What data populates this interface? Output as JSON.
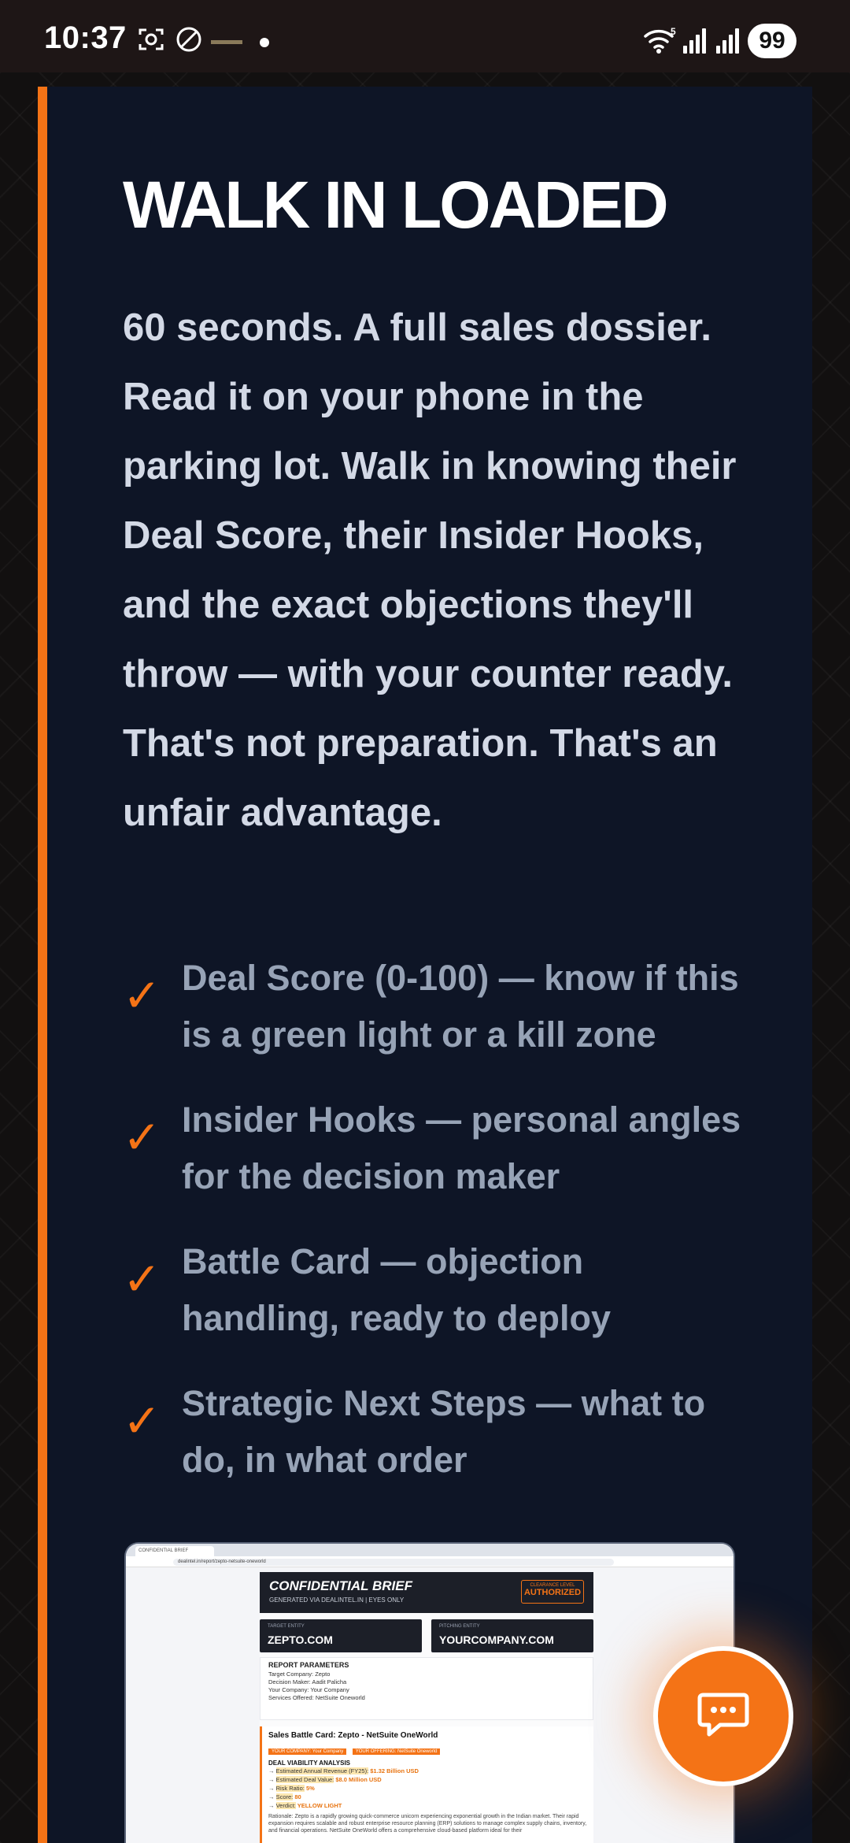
{
  "status_bar": {
    "time": "10:37",
    "battery": "99",
    "icons": [
      "screenshot-icon",
      "do-not-disturb-icon",
      "notification-dot",
      "wifi-icon",
      "signal-icon",
      "signal-icon-2"
    ]
  },
  "hero": {
    "headline": "WALK IN LOADED",
    "body": "60 seconds. A full sales dossier. Read it on your phone in the parking lot. Walk in knowing their Deal Score, their Insider Hooks, and the exact objections they'll throw — with your counter ready. That's not preparation. That's an unfair advantage."
  },
  "features": [
    {
      "check": "✓",
      "text": "Deal Score (0-100) — know if this is a green light or a kill zone"
    },
    {
      "check": "✓",
      "text": "Insider Hooks — personal angles for the decision maker"
    },
    {
      "check": "✓",
      "text": "Battle Card — objection handling, ready to deploy"
    },
    {
      "check": "✓",
      "text": "Strategic Next Steps — what to do, in what order"
    }
  ],
  "preview": {
    "tab_title": "CONFIDENTIAL BRIEF",
    "url": "dealintel.in/report/zepto-netsuite-oneworld",
    "brief_title": "CONFIDENTIAL BRIEF",
    "brief_subtitle": "GENERATED VIA DEALINTEL.IN | EYES ONLY",
    "clearance_label": "CLEARANCE LEVEL",
    "clearance_value": "AUTHORIZED",
    "target_label": "TARGET ENTITY",
    "target_value": "ZEPTO.COM",
    "pitching_label": "PITCHING ENTITY",
    "pitching_value": "YOURCOMPANY.COM",
    "params_heading": "REPORT PARAMETERS",
    "params": [
      "Target Company: Zepto",
      "Decision Maker: Aadit Palicha",
      "Your Company: Your Company",
      "Services Offered: NetSuite Oneworld"
    ],
    "battle_title": "Sales Battle Card: Zepto - NetSuite OneWorld",
    "tag_company": "YOUR COMPANY: Your Company",
    "tag_offering": "YOUR OFFERING: NetSuite Oneworld",
    "viability_heading": "DEAL VIABILITY ANALYSIS",
    "revenue_label": "Estimated Annual Revenue (FY25):",
    "revenue_value": "$1.32 Billion USD",
    "deal_label": "Estimated Deal Value:",
    "deal_value": "$8.0 Million USD",
    "risk_label": "Risk Ratio:",
    "risk_value": "5%",
    "score_label": "Score:",
    "score_value": "80",
    "verdict_label": "Verdict:",
    "verdict_value": "YELLOW LIGHT",
    "rationale": "Rationale: Zepto is a rapidly growing quick-commerce unicorn experiencing exponential growth in the Indian market. Their rapid expansion requires scalable and robust enterprise resource planning (ERP) solutions to manage complex supply chains, inventory, and financial operations. NetSuite OneWorld offers a comprehensive cloud-based platform ideal for their"
  },
  "fab": {
    "icon": "chat-icon"
  },
  "colors": {
    "accent": "#f47316",
    "card_bg": "#0e1526",
    "feature_text": "#97a3b6",
    "body_text": "#d3d9e6"
  }
}
